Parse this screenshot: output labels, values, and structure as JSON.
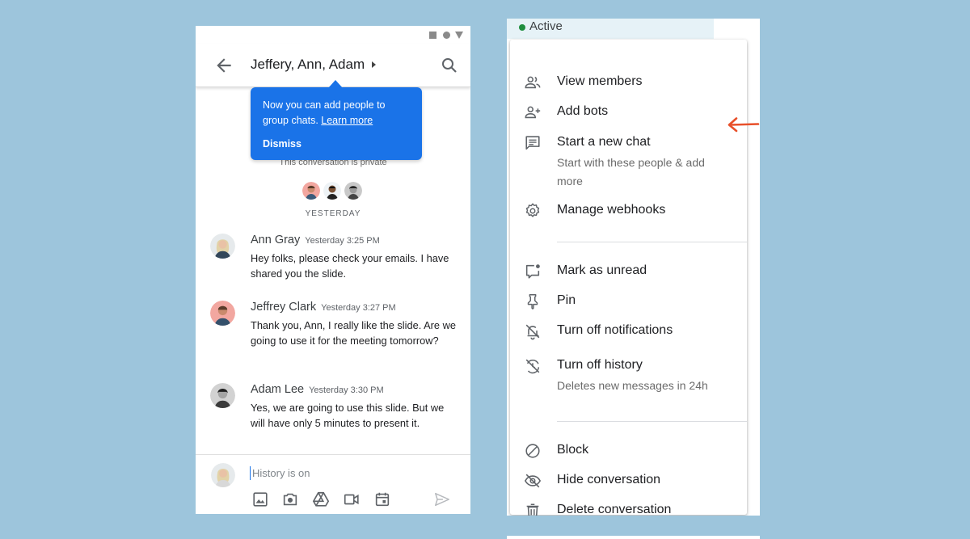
{
  "chat": {
    "title": "Jeffery, Ann, Adam",
    "tooltip": {
      "text": "Now you can add people to group chats.",
      "link": "Learn more",
      "dismiss": "Dismiss"
    },
    "private_note": "This conversation is private",
    "day_label": "YESTERDAY",
    "messages": [
      {
        "sender": "Ann Gray",
        "time": "Yesterday 3:25 PM",
        "text": "Hey folks, please check your emails. I have shared you the slide."
      },
      {
        "sender": "Jeffrey Clark",
        "time": "Yesterday 3:27 PM",
        "text": "Thank you, Ann, I really like the slide. Are we going to use it for the meeting tomorrow?"
      },
      {
        "sender": "Adam Lee",
        "time": "Yesterday 3:30 PM",
        "text": "Yes, we are going to use this slide. But we will have only 5 minutes to present it."
      }
    ],
    "composer": {
      "placeholder": "History is on"
    }
  },
  "menu": {
    "status": "Active",
    "items": [
      {
        "label": "View members",
        "icon": "people-icon"
      },
      {
        "label": "Add bots",
        "icon": "add-person-icon"
      },
      {
        "label": "Start a new chat",
        "sub": "Start with these people & add more",
        "icon": "chat-icon"
      },
      {
        "label": "Manage webhooks",
        "icon": "gear-icon"
      },
      {
        "label": "Mark as unread",
        "icon": "mark-unread-icon"
      },
      {
        "label": "Pin",
        "icon": "pin-icon"
      },
      {
        "label": "Turn off notifications",
        "icon": "bell-off-icon"
      },
      {
        "label": "Turn off history",
        "sub": "Deletes new messages in 24h",
        "icon": "history-off-icon"
      },
      {
        "label": "Block",
        "icon": "block-icon"
      },
      {
        "label": "Hide conversation",
        "icon": "eye-off-icon"
      },
      {
        "label": "Delete conversation",
        "icon": "trash-icon"
      }
    ]
  },
  "colors": {
    "accent": "#1a73e8",
    "background": "#9dc5dc",
    "active": "#1e8e3e",
    "arrow": "#e8502a"
  }
}
